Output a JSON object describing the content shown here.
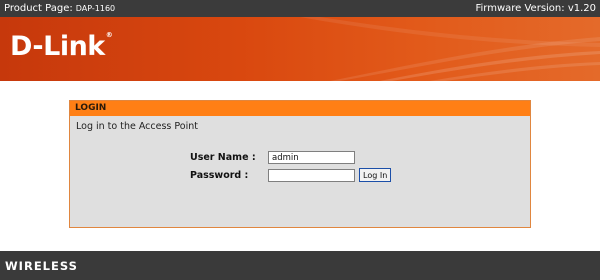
{
  "topbar": {
    "product_label": "Product Page:",
    "product_model": "DAP-1160",
    "firmware": "Firmware Version: v1.20"
  },
  "banner": {
    "logo_text": "D-Link",
    "logo_mark": "®"
  },
  "login_panel": {
    "header": "LOGIN",
    "intro": "Log in to the Access Point",
    "username_label": "User Name :",
    "username_value": "admin",
    "password_label": "Password :",
    "password_value": "",
    "login_button": "Log In"
  },
  "footer": {
    "text": "WIRELESS"
  },
  "colors": {
    "banner": "#d9480f",
    "panel_header": "#ff7f15",
    "panel_border": "#e0863f",
    "dark_bar": "#3b3b3b"
  }
}
